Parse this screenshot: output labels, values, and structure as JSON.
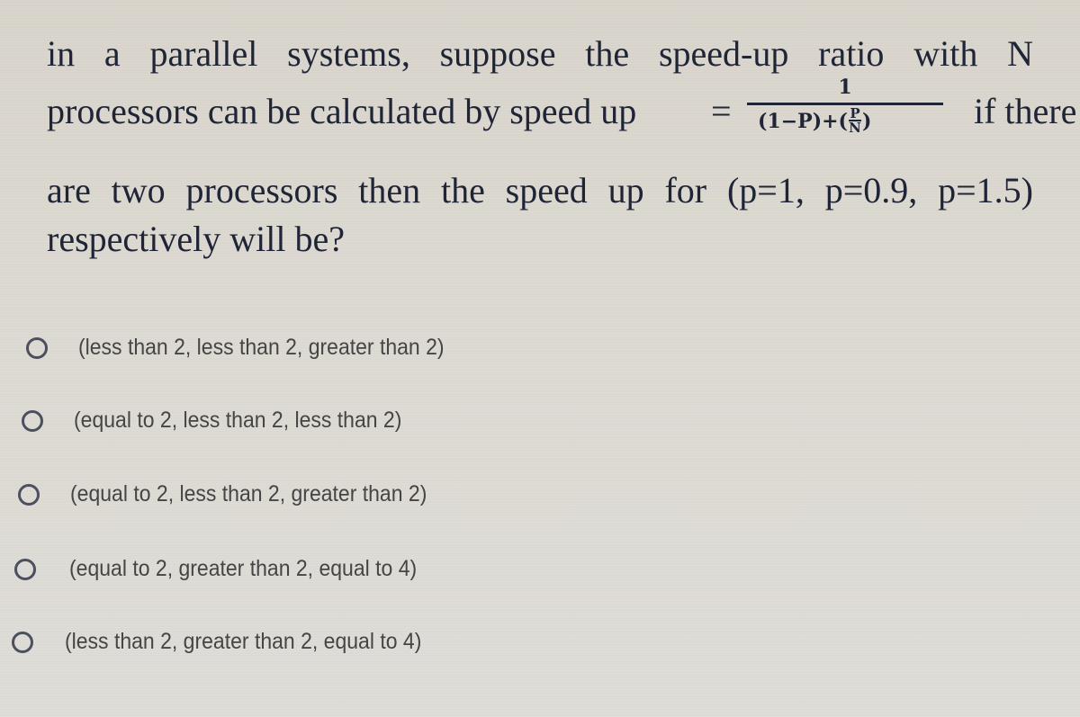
{
  "question": {
    "line1": "in a parallel systems, suppose the speed-up ratio with N",
    "line2_prefix": "processors can be calculated by speed up",
    "equals": "=",
    "formula": {
      "numerator": "1",
      "denominator_prefix": "(1−P)+(",
      "inner_numerator": "P",
      "inner_denominator": "N",
      "denominator_suffix": ")"
    },
    "line2_suffix": "if there",
    "line3": "are two processors then the speed up for (p=1, p=0.9, p=1.5)",
    "line4": "respectively will be?"
  },
  "options": [
    {
      "label": "(less than 2, less than 2, greater than 2)",
      "selected": false
    },
    {
      "label": "(equal to 2, less than 2, less than 2)",
      "selected": false
    },
    {
      "label": "(equal to 2, less than 2, greater than 2)",
      "selected": false
    },
    {
      "label": "(equal to 2, greater than 2, equal to 4)",
      "selected": false
    },
    {
      "label": "(less than 2, greater than 2, equal to 4)",
      "selected": false
    }
  ],
  "colors": {
    "background": "#dcd9d2",
    "question_text": "#1f2537",
    "option_text": "#454545",
    "radio_border": "#4b4f5e"
  }
}
